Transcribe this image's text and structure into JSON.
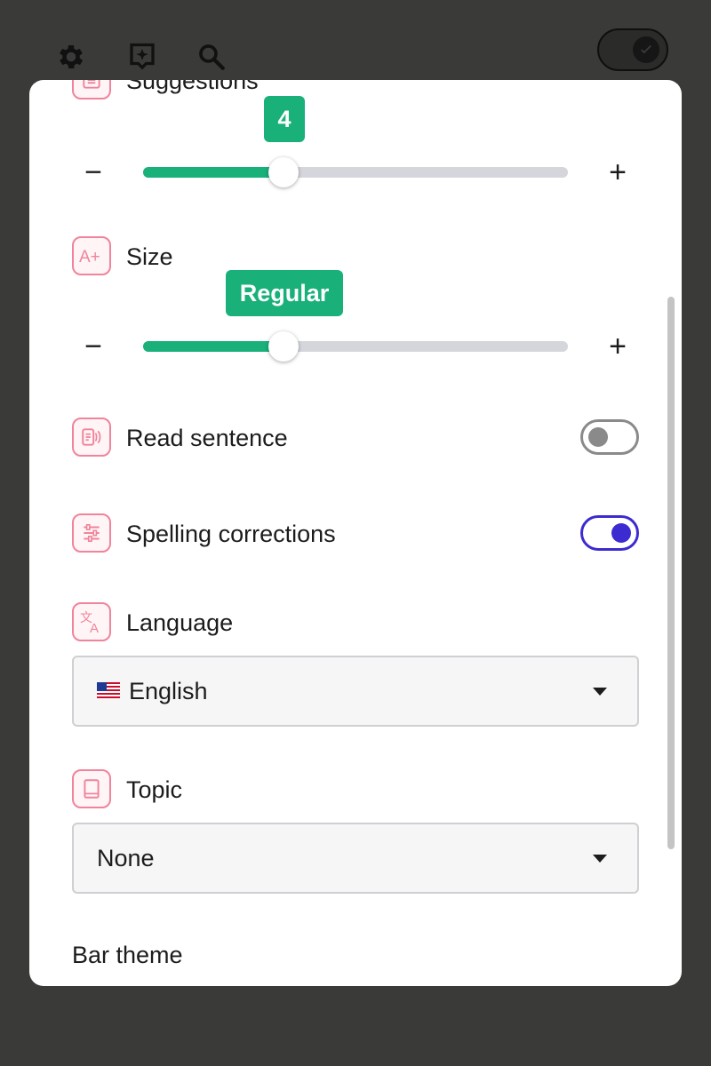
{
  "toolbar": {
    "icons": [
      "gear-icon",
      "sparkle-note-icon",
      "search-icon"
    ],
    "dark_mode_toggle": "on"
  },
  "settings": {
    "suggestions": {
      "label": "Suggestions",
      "icon": "list-icon",
      "value_label": "4",
      "slider_fraction": 0.33,
      "minus": "−",
      "plus": "+"
    },
    "size": {
      "label": "Size",
      "icon": "text-size-icon",
      "value_label": "Regular",
      "slider_fraction": 0.33,
      "minus": "−",
      "plus": "+"
    },
    "read_sentence": {
      "label": "Read sentence",
      "icon": "speaker-icon",
      "enabled": false
    },
    "spelling_corrections": {
      "label": "Spelling corrections",
      "icon": "sliders-icon",
      "enabled": true
    },
    "language": {
      "label": "Language",
      "icon": "translate-icon",
      "selected": "English",
      "flag": "us-flag-icon"
    },
    "topic": {
      "label": "Topic",
      "icon": "book-icon",
      "selected": "None"
    },
    "bar_theme": {
      "label": "Bar theme"
    }
  },
  "colors": {
    "accent_green": "#19b07a",
    "toggle_on": "#3b2bd0",
    "icon_pink": "#f0849a"
  }
}
